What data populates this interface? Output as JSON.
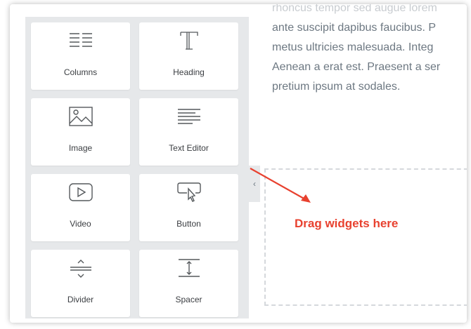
{
  "widgets": [
    {
      "label": "Columns",
      "icon": "columns-icon"
    },
    {
      "label": "Heading",
      "icon": "heading-icon"
    },
    {
      "label": "Image",
      "icon": "image-icon"
    },
    {
      "label": "Text Editor",
      "icon": "text-editor-icon"
    },
    {
      "label": "Video",
      "icon": "video-icon"
    },
    {
      "label": "Button",
      "icon": "button-icon"
    },
    {
      "label": "Divider",
      "icon": "divider-icon"
    },
    {
      "label": "Spacer",
      "icon": "spacer-icon"
    }
  ],
  "content": {
    "lines": [
      "rhoncus tempor sed augue lorem",
      "ante suscipit dapibus faucibus. P",
      "metus ultricies malesuada. Integ",
      "Aenean a erat est. Praesent a ser",
      "pretium ipsum at sodales."
    ]
  },
  "dropzone": {
    "label": "Drag widgets here"
  },
  "panel": {
    "collapse_glyph": "‹"
  },
  "colors": {
    "accent": "#e8412f",
    "panel_bg": "#e6e8ea",
    "text": "#6d7882"
  }
}
